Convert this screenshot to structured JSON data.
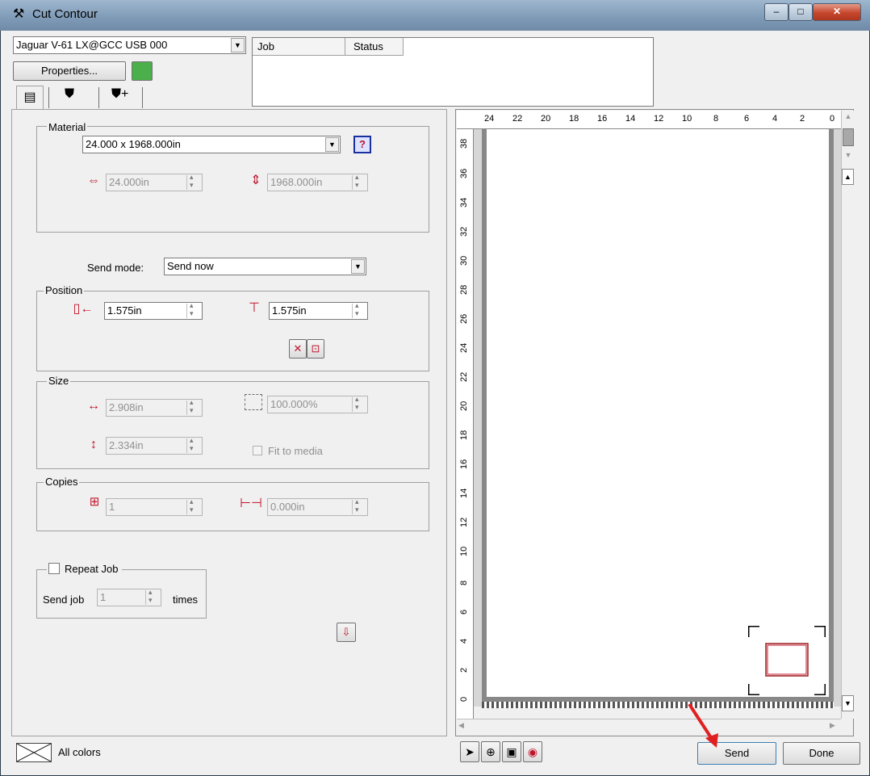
{
  "window": {
    "title": "Cut Contour"
  },
  "titlebar_buttons": {
    "minimize": "–",
    "maximize": "□",
    "close": "✕"
  },
  "device": {
    "selected": "Jaguar V-61 LX@GCC USB 000"
  },
  "properties_button": "Properties...",
  "job_table": {
    "headers": [
      "Job",
      "Status"
    ]
  },
  "tabs": [
    "material-tab",
    "cut-tab",
    "cut-plus-tab"
  ],
  "material": {
    "label": "Material",
    "size": "24.000 x 1968.000in",
    "width": "24.000in",
    "height": "1968.000in"
  },
  "send_mode": {
    "label": "Send mode:",
    "value": "Send now"
  },
  "position": {
    "label": "Position",
    "x": "1.575in",
    "y": "1.575in"
  },
  "size": {
    "label": "Size",
    "width": "2.908in",
    "height": "2.334in",
    "scale": "100.000%",
    "fit_to_media": "Fit to media"
  },
  "copies": {
    "label": "Copies",
    "count": "1",
    "spacing": "0.000in"
  },
  "repeat_job": {
    "label": "Repeat Job",
    "send_job_label": "Send job",
    "value": "1",
    "times_label": "times"
  },
  "color_filter": "All colors",
  "ruler": {
    "top": [
      "24",
      "22",
      "20",
      "18",
      "16",
      "14",
      "12",
      "10",
      "8",
      "6",
      "4",
      "2",
      "0"
    ],
    "left": [
      "38",
      "36",
      "34",
      "32",
      "30",
      "28",
      "26",
      "24",
      "22",
      "20",
      "18",
      "16",
      "14",
      "12",
      "10",
      "8",
      "6",
      "4",
      "2",
      "0"
    ]
  },
  "buttons": {
    "send": "Send",
    "done": "Done"
  }
}
